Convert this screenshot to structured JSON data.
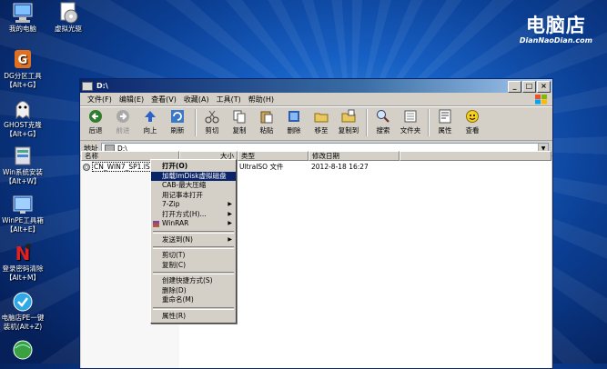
{
  "desktop": {
    "icons": [
      {
        "label": "我的电脑",
        "icon": "my-computer-icon"
      },
      {
        "label": "虚拟光驱",
        "icon": "virtual-drive-icon"
      },
      {
        "label": "DG分区工具",
        "label2": "【Alt+G】",
        "icon": "dg-partition-icon"
      },
      {
        "label": "GHOST克隆",
        "label2": "【Alt+G】",
        "icon": "ghost-icon"
      },
      {
        "label": "Win系统安装",
        "label2": "【Alt+W】",
        "icon": "win-setup-icon"
      },
      {
        "label": "WinPE工具箱",
        "label2": "【Alt+E】",
        "icon": "winpe-toolbox-icon"
      },
      {
        "label": "登录密码清除",
        "label2": "【Alt+M】",
        "icon": "password-clear-icon"
      },
      {
        "label": "电脑店PE一键",
        "label2": "装机(Alt+Z)",
        "icon": "pe-install-icon"
      }
    ],
    "brand": {
      "name": "电脑店",
      "site": "DianNaoDian.com"
    }
  },
  "window": {
    "title": "D:\\",
    "menu": [
      "文件(F)",
      "编辑(E)",
      "查看(V)",
      "收藏(A)",
      "工具(T)",
      "帮助(H)"
    ],
    "toolbar": [
      {
        "label": "后退",
        "icon": "back-arrow-icon",
        "enabled": true
      },
      {
        "label": "前进",
        "icon": "forward-arrow-icon",
        "enabled": false
      },
      {
        "label": "向上",
        "icon": "up-arrow-icon",
        "enabled": true
      },
      {
        "label": "刷新",
        "icon": "refresh-icon",
        "enabled": true
      },
      {
        "label": "剪切",
        "icon": "scissors-icon",
        "enabled": true
      },
      {
        "label": "复制",
        "icon": "copy-icon",
        "enabled": true
      },
      {
        "label": "粘贴",
        "icon": "paste-icon",
        "enabled": true
      },
      {
        "label": "删除",
        "icon": "delete-icon",
        "enabled": true
      },
      {
        "label": "移至",
        "icon": "move-to-icon",
        "enabled": true
      },
      {
        "label": "复制到",
        "icon": "copy-to-icon",
        "enabled": true
      },
      {
        "label": "搜索",
        "icon": "search-icon",
        "enabled": true
      },
      {
        "label": "文件夹",
        "icon": "folders-icon",
        "enabled": true
      },
      {
        "label": "属性",
        "icon": "properties-icon",
        "enabled": true
      },
      {
        "label": "查看",
        "icon": "views-icon",
        "enabled": true
      }
    ],
    "address": {
      "label": "地址",
      "value": "D:\\"
    },
    "columns": [
      "名称",
      "大小",
      "类型",
      "修改日期"
    ],
    "files": [
      {
        "name": "CN_WIN7_SP1.ISO",
        "size": "",
        "type": "UltraISO 文件",
        "modified": "2012-8-18 16:27"
      }
    ]
  },
  "context_menu": {
    "items": [
      {
        "label": "打开(O)",
        "bold": true
      },
      {
        "label": "加载ImDisk虚拟磁盘",
        "selected": true
      },
      {
        "label": "CAB-最大压缩"
      },
      {
        "label": "用记事本打开"
      },
      {
        "label": "7-Zip",
        "submenu": true
      },
      {
        "label": "打开方式(H)...",
        "submenu": true
      },
      {
        "label": "WinRAR",
        "submenu": true,
        "icon": "winrar-icon"
      },
      {
        "sep": true
      },
      {
        "label": "发送到(N)",
        "submenu": true
      },
      {
        "sep": true
      },
      {
        "label": "剪切(T)"
      },
      {
        "label": "复制(C)"
      },
      {
        "sep": true
      },
      {
        "label": "创建快捷方式(S)"
      },
      {
        "label": "删除(D)"
      },
      {
        "label": "重命名(M)"
      },
      {
        "sep": true
      },
      {
        "label": "属性(R)"
      }
    ]
  }
}
